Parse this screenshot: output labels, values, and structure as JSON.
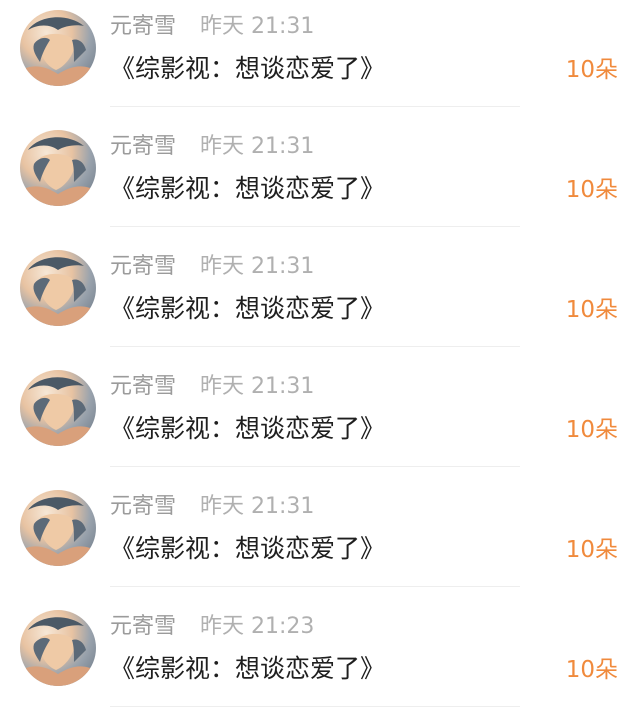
{
  "items": [
    {
      "user": "元寄雪",
      "time": "昨天 21:31",
      "title": "《综影视：想谈恋爱了》",
      "amount": "10朵",
      "avatar_icon": "user-avatar"
    },
    {
      "user": "元寄雪",
      "time": "昨天 21:31",
      "title": "《综影视：想谈恋爱了》",
      "amount": "10朵",
      "avatar_icon": "user-avatar"
    },
    {
      "user": "元寄雪",
      "time": "昨天 21:31",
      "title": "《综影视：想谈恋爱了》",
      "amount": "10朵",
      "avatar_icon": "user-avatar"
    },
    {
      "user": "元寄雪",
      "time": "昨天 21:31",
      "title": "《综影视：想谈恋爱了》",
      "amount": "10朵",
      "avatar_icon": "user-avatar"
    },
    {
      "user": "元寄雪",
      "time": "昨天 21:31",
      "title": "《综影视：想谈恋爱了》",
      "amount": "10朵",
      "avatar_icon": "user-avatar"
    },
    {
      "user": "元寄雪",
      "time": "昨天 21:23",
      "title": "《综影视：想谈恋爱了》",
      "amount": "10朵",
      "avatar_icon": "user-avatar"
    }
  ],
  "colors": {
    "name": "#9b9b9b",
    "time": "#b0b0b0",
    "title": "#1f1f1f",
    "amount": "#f08a3c",
    "divider": "#eeeeee"
  }
}
